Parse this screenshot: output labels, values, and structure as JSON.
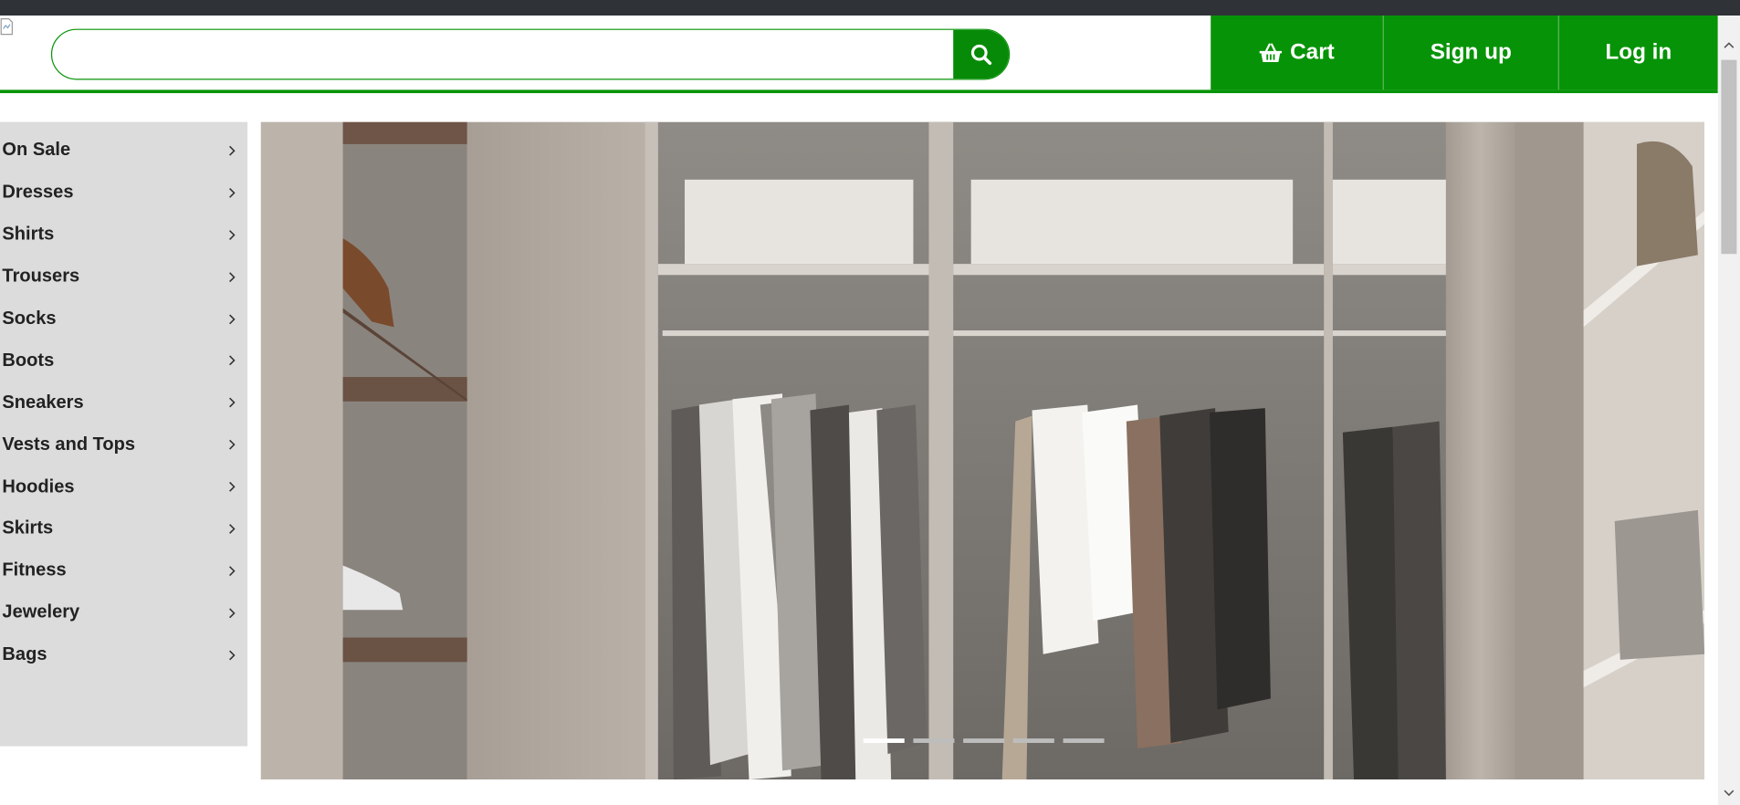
{
  "header": {
    "search": {
      "value": "",
      "placeholder": ""
    },
    "nav": {
      "cart_label": "Cart",
      "signup_label": "Sign up",
      "login_label": "Log in"
    }
  },
  "categories": [
    {
      "label": "On Sale"
    },
    {
      "label": "Dresses"
    },
    {
      "label": "Shirts"
    },
    {
      "label": "Trousers"
    },
    {
      "label": "Socks"
    },
    {
      "label": "Boots"
    },
    {
      "label": "Sneakers"
    },
    {
      "label": "Vests and Tops"
    },
    {
      "label": "Hoodies"
    },
    {
      "label": "Skirts"
    },
    {
      "label": "Fitness"
    },
    {
      "label": "Jewelery"
    },
    {
      "label": "Bags"
    }
  ],
  "carousel": {
    "slide_count": 5,
    "active_slide": 1
  },
  "icons": {
    "search": "search-icon",
    "cart": "basket-icon",
    "category_arrow": "chevron-right-icon"
  },
  "colors": {
    "brand_green": "#079307",
    "sidebar_bg": "#dcdcdc",
    "top_strip": "#2f3237"
  }
}
